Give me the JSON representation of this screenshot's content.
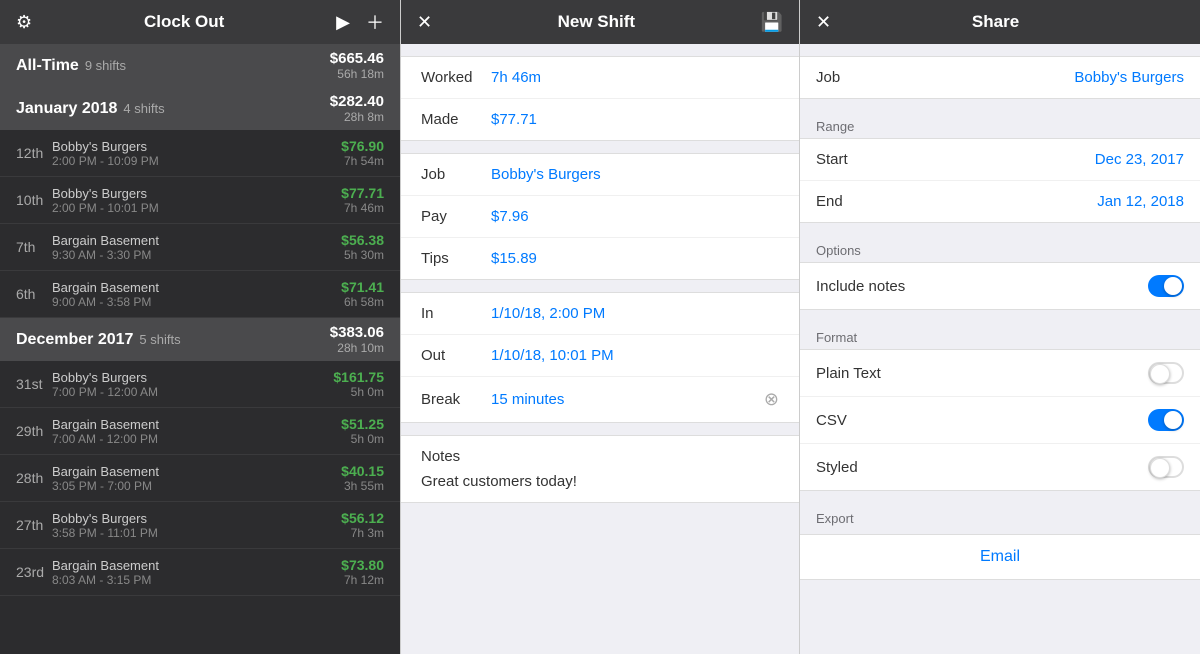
{
  "left_panel": {
    "title": "Clock Out",
    "sections": [
      {
        "title": "All-Time",
        "subtitle": "9 shifts",
        "amount": "$665.46",
        "time": "56h 18m",
        "shifts": []
      },
      {
        "title": "January 2018",
        "subtitle": "4 shifts",
        "amount": "$282.40",
        "time": "28h 8m",
        "shifts": [
          {
            "day": "12th",
            "place": "Bobby's Burgers",
            "time_range": "2:00 PM - 10:09 PM",
            "amount": "$76.90",
            "duration": "7h 54m"
          },
          {
            "day": "10th",
            "place": "Bobby's Burgers",
            "time_range": "2:00 PM - 10:01 PM",
            "amount": "$77.71",
            "duration": "7h 46m"
          },
          {
            "day": "7th",
            "place": "Bargain Basement",
            "time_range": "9:30 AM - 3:30 PM",
            "amount": "$56.38",
            "duration": "5h 30m"
          },
          {
            "day": "6th",
            "place": "Bargain Basement",
            "time_range": "9:00 AM - 3:58 PM",
            "amount": "$71.41",
            "duration": "6h 58m"
          }
        ]
      },
      {
        "title": "December 2017",
        "subtitle": "5 shifts",
        "amount": "$383.06",
        "time": "28h 10m",
        "shifts": [
          {
            "day": "31st",
            "place": "Bobby's Burgers",
            "time_range": "7:00 PM - 12:00 AM",
            "amount": "$161.75",
            "duration": "5h 0m"
          },
          {
            "day": "29th",
            "place": "Bargain Basement",
            "time_range": "7:00 AM - 12:00 PM",
            "amount": "$51.25",
            "duration": "5h 0m"
          },
          {
            "day": "28th",
            "place": "Bargain Basement",
            "time_range": "3:05 PM - 7:00 PM",
            "amount": "$40.15",
            "duration": "3h 55m"
          },
          {
            "day": "27th",
            "place": "Bobby's Burgers",
            "time_range": "3:58 PM - 11:01 PM",
            "amount": "$56.12",
            "duration": "7h 3m"
          },
          {
            "day": "23rd",
            "place": "Bargain Basement",
            "time_range": "8:03 AM - 3:15 PM",
            "amount": "$73.80",
            "duration": "7h 12m"
          }
        ]
      }
    ]
  },
  "mid_panel": {
    "title": "New Shift",
    "summary": {
      "worked_label": "Worked",
      "worked_value": "7h 46m",
      "made_label": "Made",
      "made_value": "$77.71"
    },
    "details": {
      "job_label": "Job",
      "job_value": "Bobby's Burgers",
      "pay_label": "Pay",
      "pay_value": "$7.96",
      "tips_label": "Tips",
      "tips_value": "$15.89",
      "in_label": "In",
      "in_value": "1/10/18, 2:00 PM",
      "out_label": "Out",
      "out_value": "1/10/18, 10:01 PM",
      "break_label": "Break",
      "break_value": "15 minutes"
    },
    "notes": {
      "title": "Notes",
      "text": "Great customers today!"
    }
  },
  "right_panel": {
    "title": "Share",
    "job_label": "Job",
    "job_value": "Bobby's Burgers",
    "range_label": "Range",
    "start_label": "Start",
    "start_value": "Dec 23, 2017",
    "end_label": "End",
    "end_value": "Jan 12, 2018",
    "options_label": "Options",
    "include_notes_label": "Include notes",
    "include_notes_value": true,
    "format_label": "Format",
    "formats": [
      {
        "label": "Plain Text",
        "selected": false
      },
      {
        "label": "CSV",
        "selected": true
      },
      {
        "label": "Styled",
        "selected": false
      }
    ],
    "export_label": "Export",
    "email_label": "Email"
  }
}
